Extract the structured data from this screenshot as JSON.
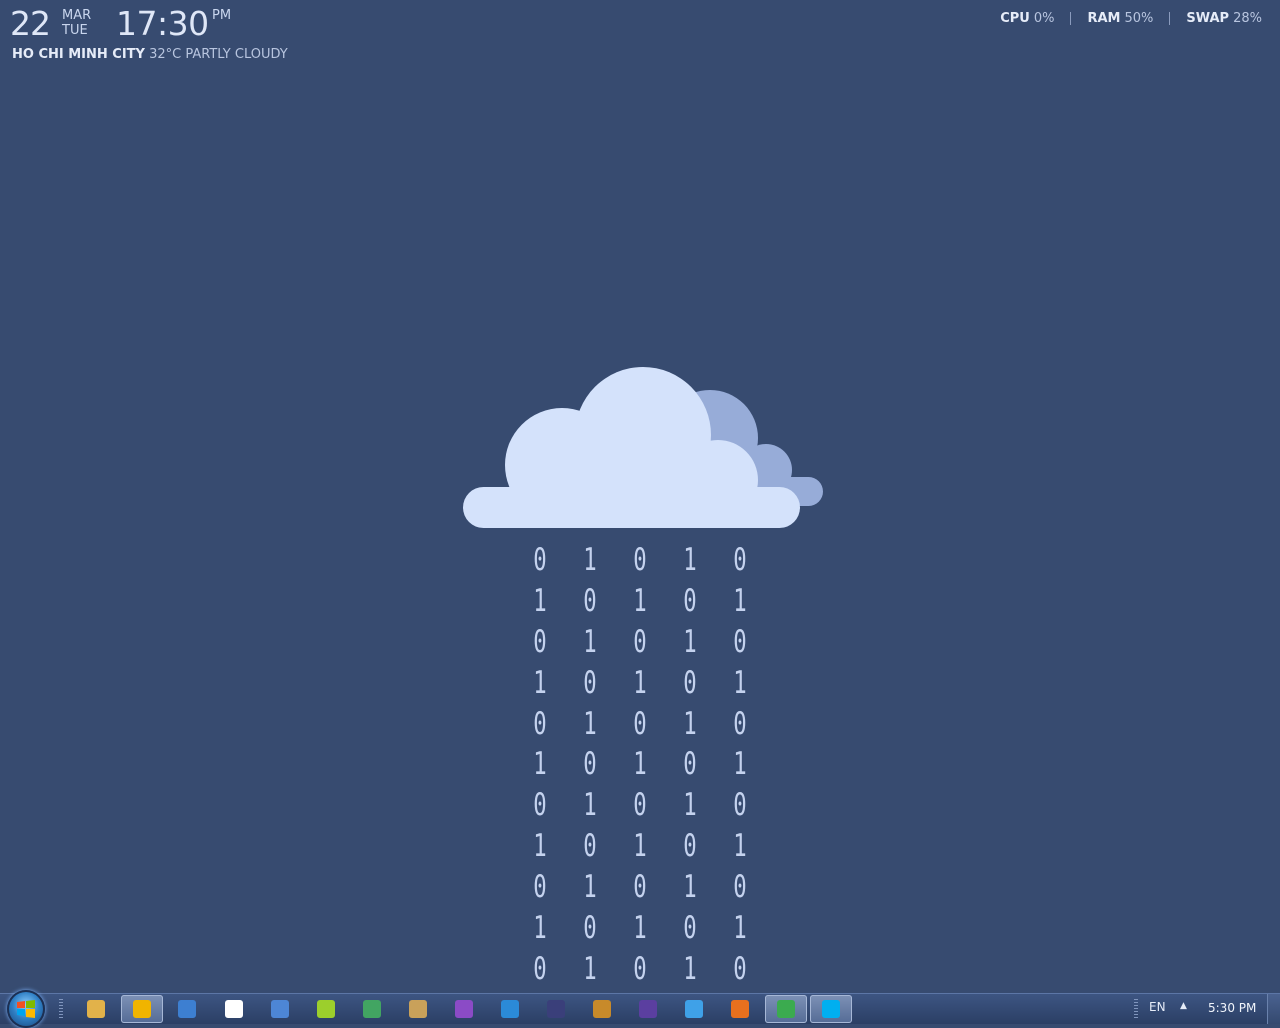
{
  "clock": {
    "day": "22",
    "month": "MAR",
    "weekday": "TUE",
    "time": "17:30",
    "ampm": "PM"
  },
  "weather": {
    "city": "HO CHI MINH CITY",
    "condition": "32°C PARTLY CLOUDY"
  },
  "system": {
    "cpu_label": "CPU",
    "cpu_value": "0%",
    "ram_label": "RAM",
    "ram_value": "50%",
    "swap_label": "SWAP",
    "swap_value": "28%"
  },
  "binary_rain": [
    [
      "0",
      "1",
      "0",
      "1",
      "0"
    ],
    [
      "1",
      "0",
      "1",
      "0",
      "1"
    ],
    [
      "0",
      "1",
      "0",
      "1",
      "0"
    ],
    [
      "1",
      "0",
      "1",
      "0",
      "1"
    ],
    [
      "0",
      "1",
      "0",
      "1",
      "0"
    ],
    [
      "1",
      "0",
      "1",
      "0",
      "1"
    ],
    [
      "0",
      "1",
      "0",
      "1",
      "0"
    ],
    [
      "1",
      "0",
      "1",
      "0",
      "1"
    ],
    [
      "0",
      "1",
      "0",
      "1",
      "0"
    ],
    [
      "1",
      "0",
      "1",
      "0",
      "1"
    ],
    [
      "0",
      "1",
      "0",
      "1",
      "0"
    ]
  ],
  "colors": {
    "desktop_bg": "#374b70",
    "cloud_front": "#d4e2fb",
    "cloud_back": "#97acd8",
    "rain_digit": "#c4d2ee"
  },
  "taskbar": {
    "pinned": [
      {
        "name": "file-explorer-icon",
        "color": "#e2b24a",
        "active": false
      },
      {
        "name": "outlook-icon",
        "color": "#f0b400",
        "active": true
      },
      {
        "name": "remote-desktop-icon",
        "color": "#3d7fd1",
        "active": false
      },
      {
        "name": "vnc-icon",
        "color": "#ffffff",
        "active": false
      },
      {
        "name": "connection-manager-icon",
        "color": "#4d86d6",
        "active": false
      },
      {
        "name": "pidgin-icon",
        "color": "#9ccf2c",
        "active": false
      },
      {
        "name": "app-window-icon",
        "color": "#42a562",
        "active": false
      },
      {
        "name": "tools-icon",
        "color": "#c9a15a",
        "active": false
      },
      {
        "name": "visual-studio-icon",
        "color": "#8b4bc6",
        "active": false
      },
      {
        "name": "vscode-icon",
        "color": "#2b8ad8",
        "active": false
      },
      {
        "name": "eclipse-icon",
        "color": "#3a3f7a",
        "active": false
      },
      {
        "name": "notes-icon",
        "color": "#c88a2a",
        "active": false
      },
      {
        "name": "media-player-icon",
        "color": "#5b3fa0",
        "active": false
      },
      {
        "name": "internet-explorer-icon",
        "color": "#3fa1e8",
        "active": false
      },
      {
        "name": "firefox-icon",
        "color": "#e8701e",
        "active": false
      },
      {
        "name": "chrome-icon",
        "color": "#3bab4f",
        "active": true
      },
      {
        "name": "skype-icon",
        "color": "#00aff0",
        "active": true
      }
    ],
    "language": "EN",
    "tray_clock": "5:30 PM"
  }
}
